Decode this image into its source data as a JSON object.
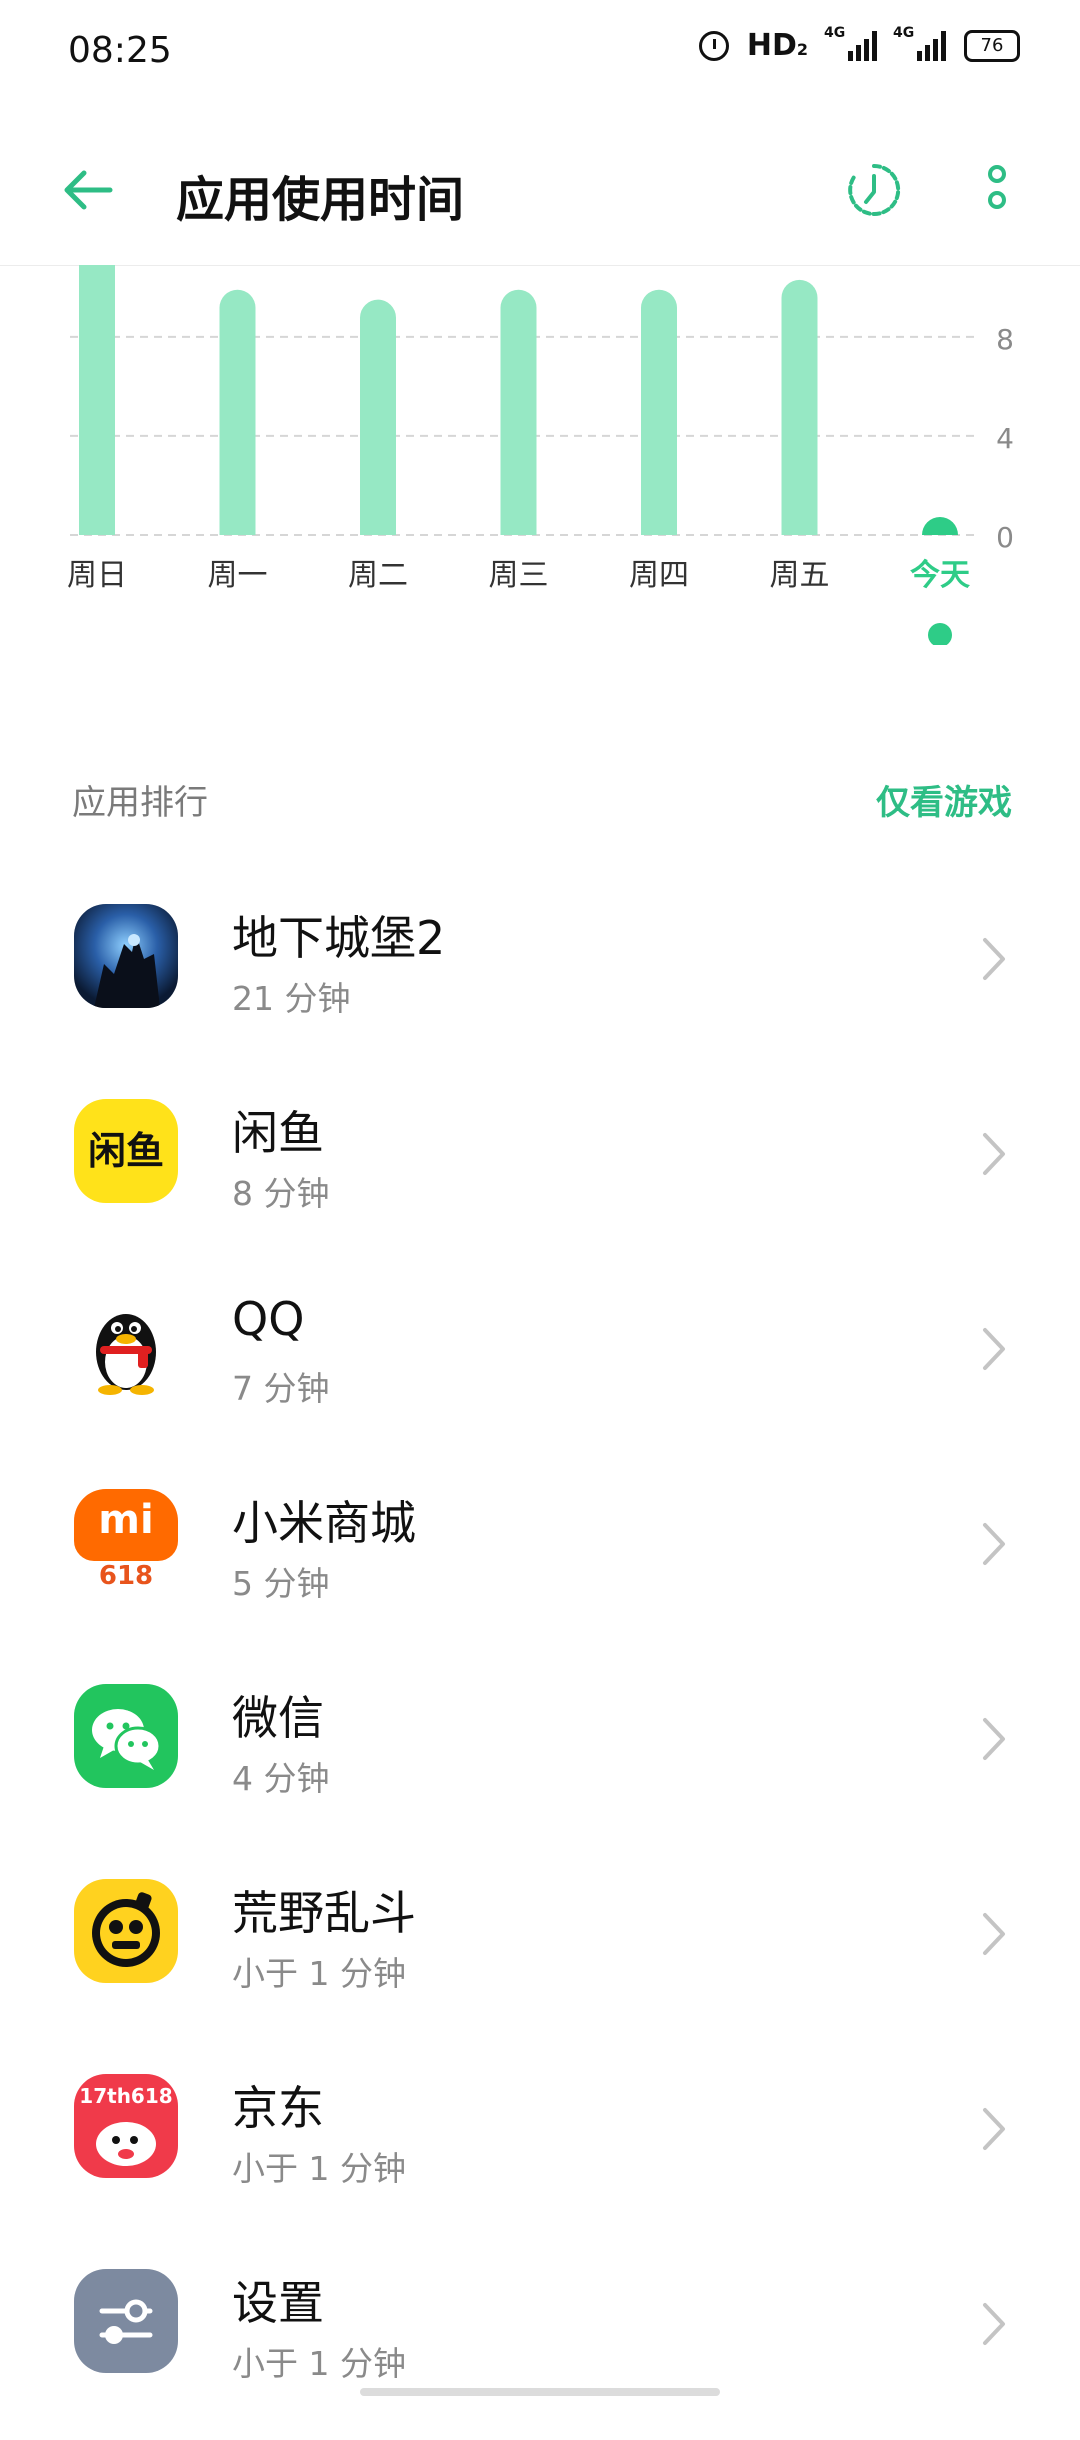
{
  "status_bar": {
    "time": "08:25",
    "network_label": "HD",
    "network_sub": "2",
    "sig1_label": "4G",
    "sig2_label": "4G",
    "battery": "76"
  },
  "header": {
    "title": "应用使用时间",
    "back_icon": "arrow-left-icon",
    "history_icon": "clock-history-icon",
    "more_icon": "more-vertical-icon",
    "accent": "#2ebd85"
  },
  "chart_data": {
    "type": "bar",
    "categories": [
      "周日",
      "周一",
      "周二",
      "周三",
      "周四",
      "周五",
      "今天"
    ],
    "values": [
      12.5,
      9.9,
      9.5,
      9.9,
      9.9,
      10.3,
      0.35
    ],
    "y_ticks": [
      "8",
      "4",
      "0"
    ],
    "y_tick_values": [
      8,
      4,
      0
    ],
    "ylim": [
      0,
      10.9
    ],
    "selected_index": 6,
    "bar_color": "#96e8c4",
    "selected_color": "#2ecc87",
    "grid": true
  },
  "section": {
    "label": "应用排行",
    "action": "仅看游戏"
  },
  "apps": [
    {
      "name": "地下城堡2",
      "duration": "21 分钟",
      "icon": "dungeon-castle-icon"
    },
    {
      "name": "闲鱼",
      "duration": "8 分钟",
      "icon": "xianyu-icon",
      "icon_text": "闲鱼"
    },
    {
      "name": "QQ",
      "duration": "7 分钟",
      "icon": "qq-penguin-icon"
    },
    {
      "name": "小米商城",
      "duration": "5 分钟",
      "icon": "mi-store-icon",
      "icon_text": "mi",
      "icon_sub": "618"
    },
    {
      "name": "微信",
      "duration": "4 分钟",
      "icon": "wechat-icon"
    },
    {
      "name": "荒野乱斗",
      "duration": "小于 1 分钟",
      "icon": "brawl-stars-icon"
    },
    {
      "name": "京东",
      "duration": "小于 1 分钟",
      "icon": "jd-icon",
      "icon_text": "17th618"
    },
    {
      "name": "设置",
      "duration": "小于 1 分钟",
      "icon": "settings-icon"
    }
  ]
}
